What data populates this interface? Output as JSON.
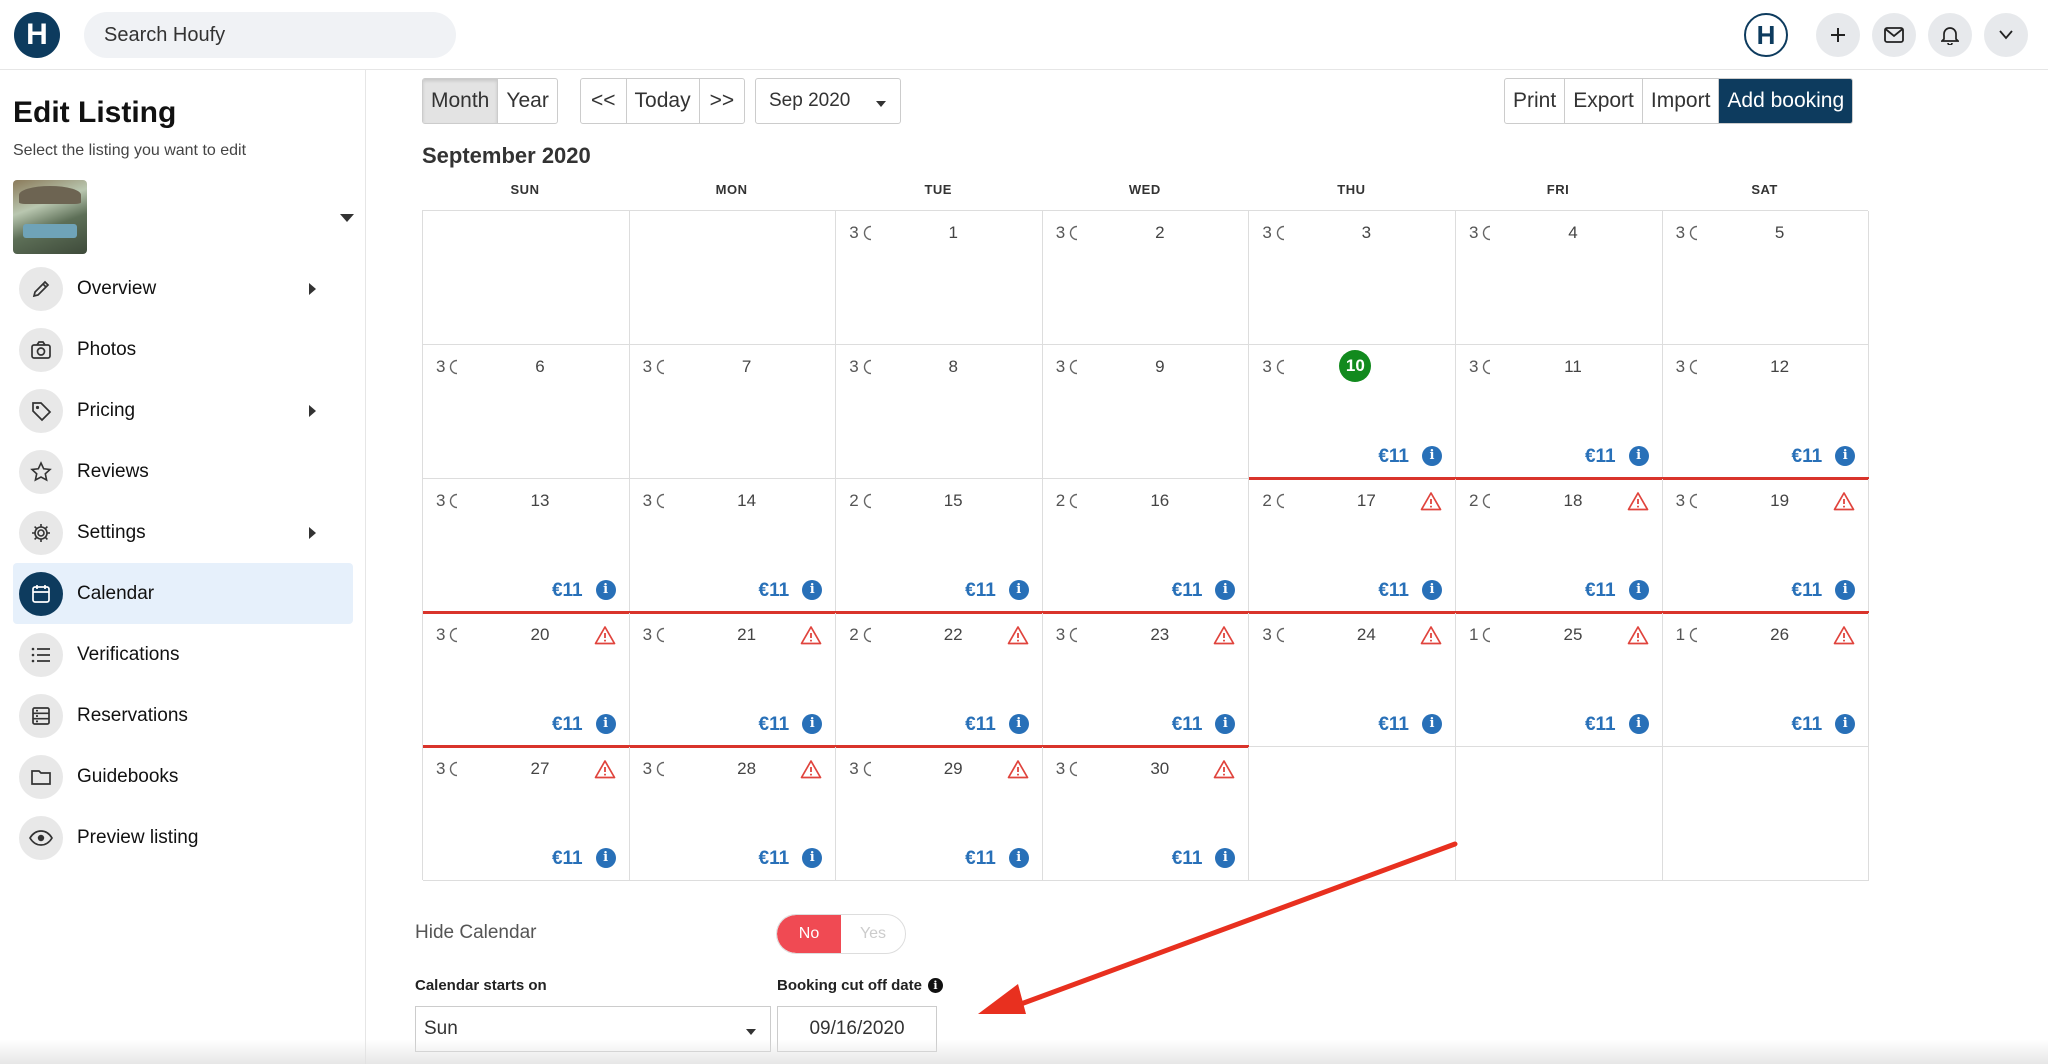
{
  "header": {
    "logo_letter": "H",
    "search_placeholder": "Search Houfy",
    "avatar_letter": "H",
    "icons": [
      "plus-icon",
      "mail-icon",
      "bell-icon",
      "chevron-down-icon"
    ]
  },
  "sidebar": {
    "title": "Edit Listing",
    "subtitle": "Select the listing you want to edit",
    "items": [
      {
        "label": "Overview",
        "icon": "pencil-icon",
        "has_submenu": true,
        "active": false
      },
      {
        "label": "Photos",
        "icon": "camera-icon",
        "has_submenu": false,
        "active": false
      },
      {
        "label": "Pricing",
        "icon": "tag-icon",
        "has_submenu": true,
        "active": false
      },
      {
        "label": "Reviews",
        "icon": "star-icon",
        "has_submenu": false,
        "active": false
      },
      {
        "label": "Settings",
        "icon": "gear-icon",
        "has_submenu": true,
        "active": false
      },
      {
        "label": "Calendar",
        "icon": "calendar-icon",
        "has_submenu": false,
        "active": true
      },
      {
        "label": "Verifications",
        "icon": "list-icon",
        "has_submenu": false,
        "active": false
      },
      {
        "label": "Reservations",
        "icon": "stack-icon",
        "has_submenu": false,
        "active": false
      },
      {
        "label": "Guidebooks",
        "icon": "folder-icon",
        "has_submenu": false,
        "active": false
      },
      {
        "label": "Preview listing",
        "icon": "eye-icon",
        "has_submenu": false,
        "active": false
      }
    ]
  },
  "toolbar": {
    "view_month": "Month",
    "view_year": "Year",
    "prev": "<<",
    "today": "Today",
    "next": ">>",
    "month_select": "Sep 2020",
    "print": "Print",
    "export": "Export",
    "import": "Import",
    "add_booking": "Add booking"
  },
  "calendar": {
    "title": "September 2020",
    "weekdays": [
      "SUN",
      "MON",
      "TUE",
      "WED",
      "THU",
      "FRI",
      "SAT"
    ],
    "today": 10,
    "weeks": [
      [
        null,
        null,
        {
          "day": "1",
          "nights": "3",
          "price": "",
          "warning": false,
          "redline": false
        },
        {
          "day": "2",
          "nights": "3",
          "price": "",
          "warning": false,
          "redline": false
        },
        {
          "day": "3",
          "nights": "3",
          "price": "",
          "warning": false,
          "redline": false
        },
        {
          "day": "4",
          "nights": "3",
          "price": "",
          "warning": false,
          "redline": false
        },
        {
          "day": "5",
          "nights": "3",
          "price": "",
          "warning": false,
          "redline": false
        }
      ],
      [
        {
          "day": "6",
          "nights": "3",
          "price": "",
          "warning": false,
          "redline": false
        },
        {
          "day": "7",
          "nights": "3",
          "price": "",
          "warning": false,
          "redline": false
        },
        {
          "day": "8",
          "nights": "3",
          "price": "",
          "warning": false,
          "redline": false
        },
        {
          "day": "9",
          "nights": "3",
          "price": "",
          "warning": false,
          "redline": false
        },
        {
          "day": "10",
          "nights": "3",
          "price": "€11",
          "warning": false,
          "redline": true
        },
        {
          "day": "11",
          "nights": "3",
          "price": "€11",
          "warning": false,
          "redline": true
        },
        {
          "day": "12",
          "nights": "3",
          "price": "€11",
          "warning": false,
          "redline": true
        }
      ],
      [
        {
          "day": "13",
          "nights": "3",
          "price": "€11",
          "warning": false,
          "redline": true
        },
        {
          "day": "14",
          "nights": "3",
          "price": "€11",
          "warning": false,
          "redline": true
        },
        {
          "day": "15",
          "nights": "2",
          "price": "€11",
          "warning": false,
          "redline": true
        },
        {
          "day": "16",
          "nights": "2",
          "price": "€11",
          "warning": false,
          "redline": true
        },
        {
          "day": "17",
          "nights": "2",
          "price": "€11",
          "warning": true,
          "redline": true
        },
        {
          "day": "18",
          "nights": "2",
          "price": "€11",
          "warning": true,
          "redline": true
        },
        {
          "day": "19",
          "nights": "3",
          "price": "€11",
          "warning": true,
          "redline": true
        }
      ],
      [
        {
          "day": "20",
          "nights": "3",
          "price": "€11",
          "warning": true,
          "redline": true
        },
        {
          "day": "21",
          "nights": "3",
          "price": "€11",
          "warning": true,
          "redline": true
        },
        {
          "day": "22",
          "nights": "2",
          "price": "€11",
          "warning": true,
          "redline": true
        },
        {
          "day": "23",
          "nights": "3",
          "price": "€11",
          "warning": true,
          "redline": true
        },
        {
          "day": "24",
          "nights": "3",
          "price": "€11",
          "warning": true,
          "redline": false
        },
        {
          "day": "25",
          "nights": "1",
          "price": "€11",
          "warning": true,
          "redline": false
        },
        {
          "day": "26",
          "nights": "1",
          "price": "€11",
          "warning": true,
          "redline": false
        }
      ],
      [
        {
          "day": "27",
          "nights": "3",
          "price": "€11",
          "warning": true,
          "redline": false
        },
        {
          "day": "28",
          "nights": "3",
          "price": "€11",
          "warning": true,
          "redline": false
        },
        {
          "day": "29",
          "nights": "3",
          "price": "€11",
          "warning": true,
          "redline": false
        },
        {
          "day": "30",
          "nights": "3",
          "price": "€11",
          "warning": true,
          "redline": false
        },
        null,
        null,
        null
      ]
    ]
  },
  "settings": {
    "hide_calendar_label": "Hide Calendar",
    "toggle_no": "No",
    "toggle_yes": "Yes",
    "hide_calendar_value": "No",
    "starts_on_label": "Calendar starts on",
    "starts_on_value": "Sun",
    "cutoff_label": "Booking cut off date",
    "cutoff_value": "09/16/2020"
  },
  "colors": {
    "brand": "#0d3b5e",
    "price": "#2870b8",
    "warning": "#e0443d",
    "today": "#128a1e",
    "toggle_on": "#f04a53",
    "annotation_arrow": "#e8301f"
  }
}
